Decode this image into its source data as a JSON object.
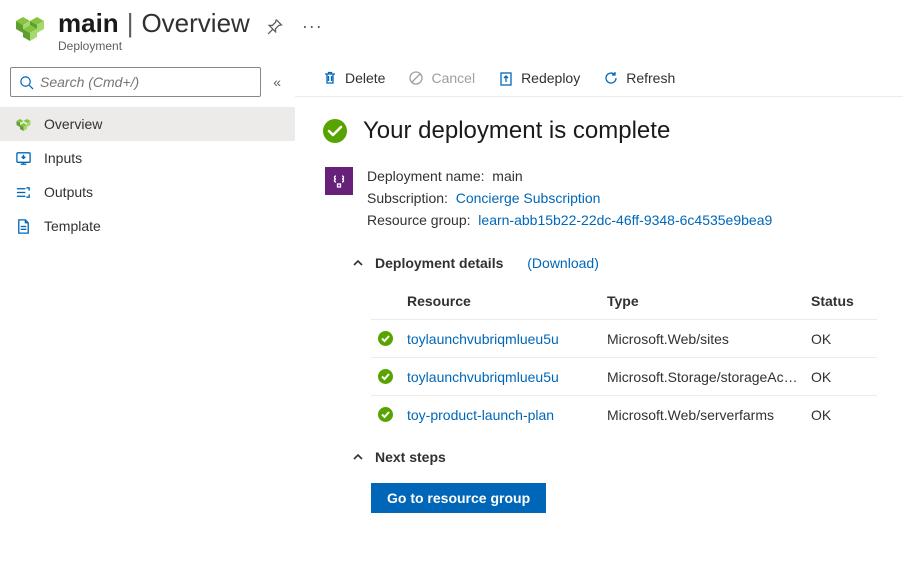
{
  "header": {
    "title_main": "main",
    "title_section": "Overview",
    "subtitle": "Deployment"
  },
  "sidebar": {
    "search_placeholder": "Search (Cmd+/)",
    "items": [
      {
        "label": "Overview",
        "active": true
      },
      {
        "label": "Inputs"
      },
      {
        "label": "Outputs"
      },
      {
        "label": "Template"
      }
    ]
  },
  "toolbar": {
    "delete": "Delete",
    "cancel": "Cancel",
    "redeploy": "Redeploy",
    "refresh": "Refresh"
  },
  "status": {
    "message": "Your deployment is complete"
  },
  "meta": {
    "dep_label": "Deployment name:",
    "dep_value": "main",
    "sub_label": "Subscription:",
    "sub_value": "Concierge Subscription",
    "rg_label": "Resource group:",
    "rg_value": "learn-abb15b22-22dc-46ff-9348-6c4535e9bea9"
  },
  "details": {
    "heading": "Deployment details",
    "download": "(Download)",
    "columns": {
      "resource": "Resource",
      "type": "Type",
      "status": "Status"
    },
    "rows": [
      {
        "resource": "toylaunchvubriqmlueu5u",
        "type": "Microsoft.Web/sites",
        "status": "OK"
      },
      {
        "resource": "toylaunchvubriqmlueu5u",
        "type": "Microsoft.Storage/storageAcc…",
        "status": "OK"
      },
      {
        "resource": "toy-product-launch-plan",
        "type": "Microsoft.Web/serverfarms",
        "status": "OK"
      }
    ]
  },
  "next": {
    "heading": "Next steps",
    "button": "Go to resource group"
  }
}
